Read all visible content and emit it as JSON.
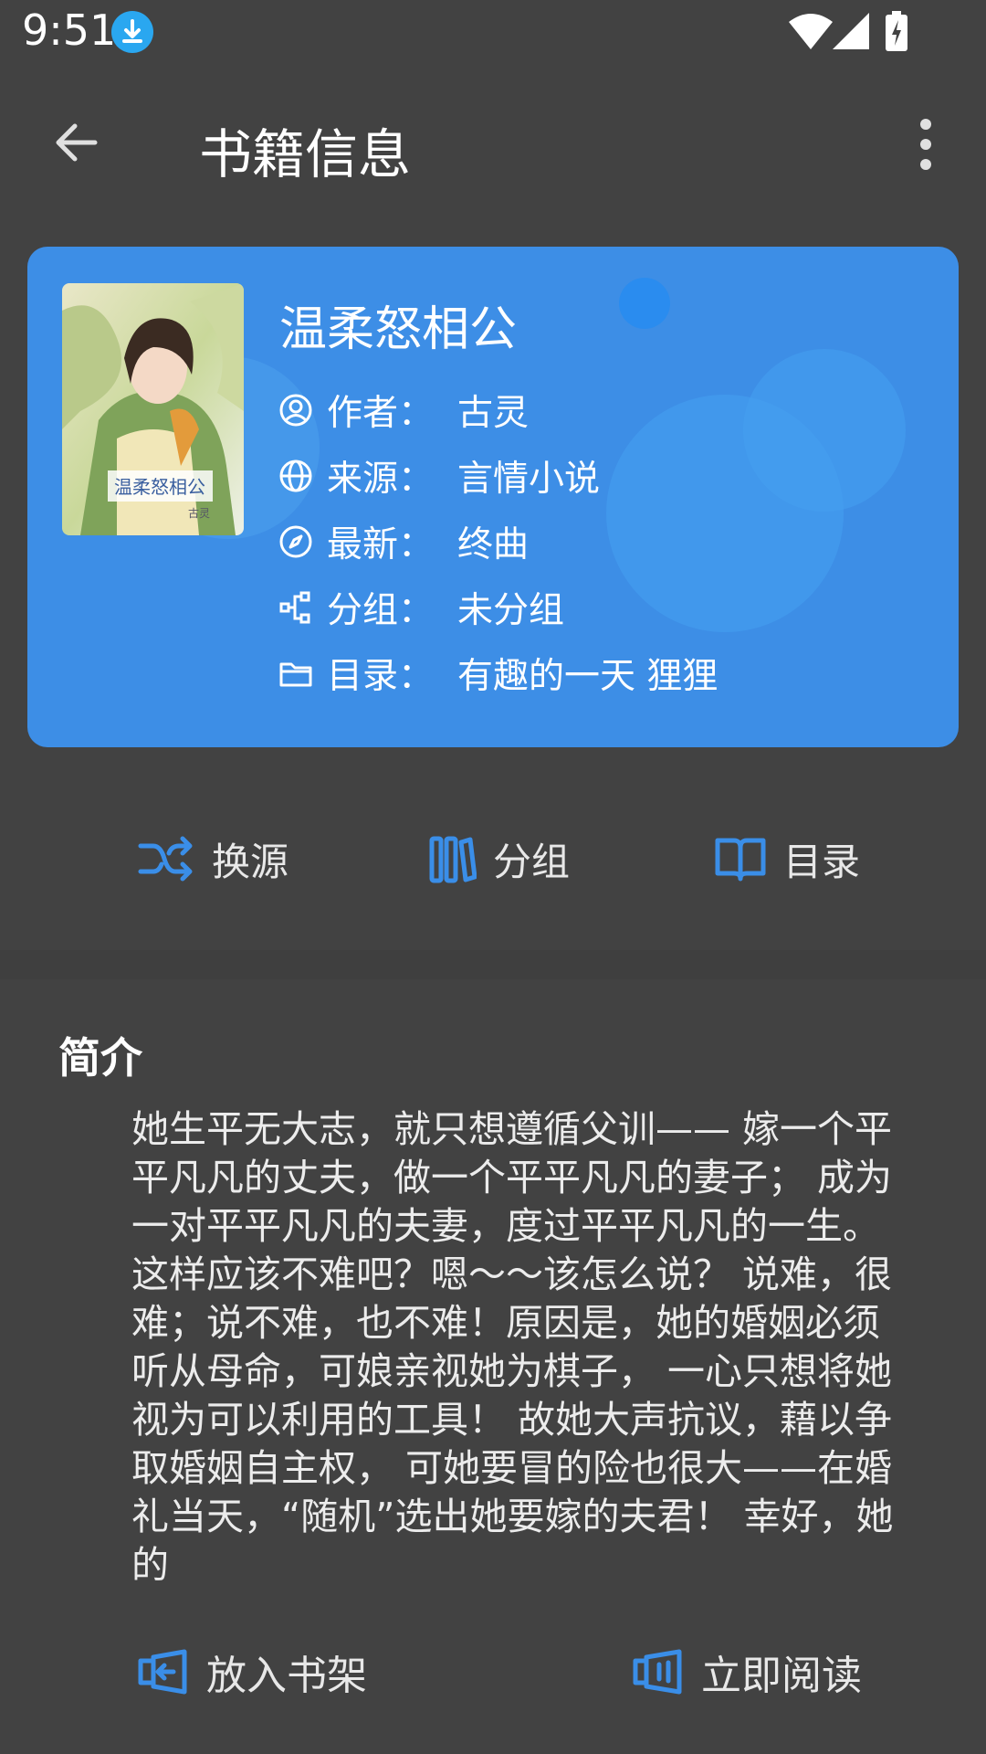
{
  "status_bar": {
    "time": "9:51"
  },
  "toolbar": {
    "title": "书籍信息"
  },
  "book": {
    "title": "温柔怒相公",
    "cover_text": "温柔怒相公",
    "cover_author": "古灵",
    "info": [
      {
        "icon": "user-circle-icon",
        "label": "作者：",
        "value": "古灵"
      },
      {
        "icon": "globe-icon",
        "label": "来源：",
        "value": "言情小说"
      },
      {
        "icon": "compass-icon",
        "label": "最新：",
        "value": "终曲"
      },
      {
        "icon": "group-icon",
        "label": "分组：",
        "value": "未分组"
      },
      {
        "icon": "folder-icon",
        "label": "目录：",
        "value": "有趣的一天 狸狸"
      }
    ]
  },
  "actions": {
    "change_source": "换源",
    "group": "分组",
    "toc": "目录"
  },
  "intro": {
    "heading": "简介",
    "text": "她生平无大志，就只想遵循父训—— 嫁一个平平凡凡的丈夫，做一个平平凡凡的妻子； 成为一对平平凡凡的夫妻，度过平平凡凡的一生。 这样应该不难吧？嗯～～该怎么说？ 说难，很难；说不难，也不难！原因是，她的婚姻必须听从母命，可娘亲视她为棋子， 一心只想将她视为可以利用的工具！ 故她大声抗议，藉以争取婚姻自主权， 可她要冒的险也很大——在婚礼当天，“随机”选出她要嫁的夫君！ 幸好，她的"
  },
  "bottom_bar": {
    "add_shelf": "放入书架",
    "read_now": "立即阅读"
  },
  "colors": {
    "background": "#424242",
    "card": "#3d8ee6",
    "accent": "#3a8ee8"
  }
}
